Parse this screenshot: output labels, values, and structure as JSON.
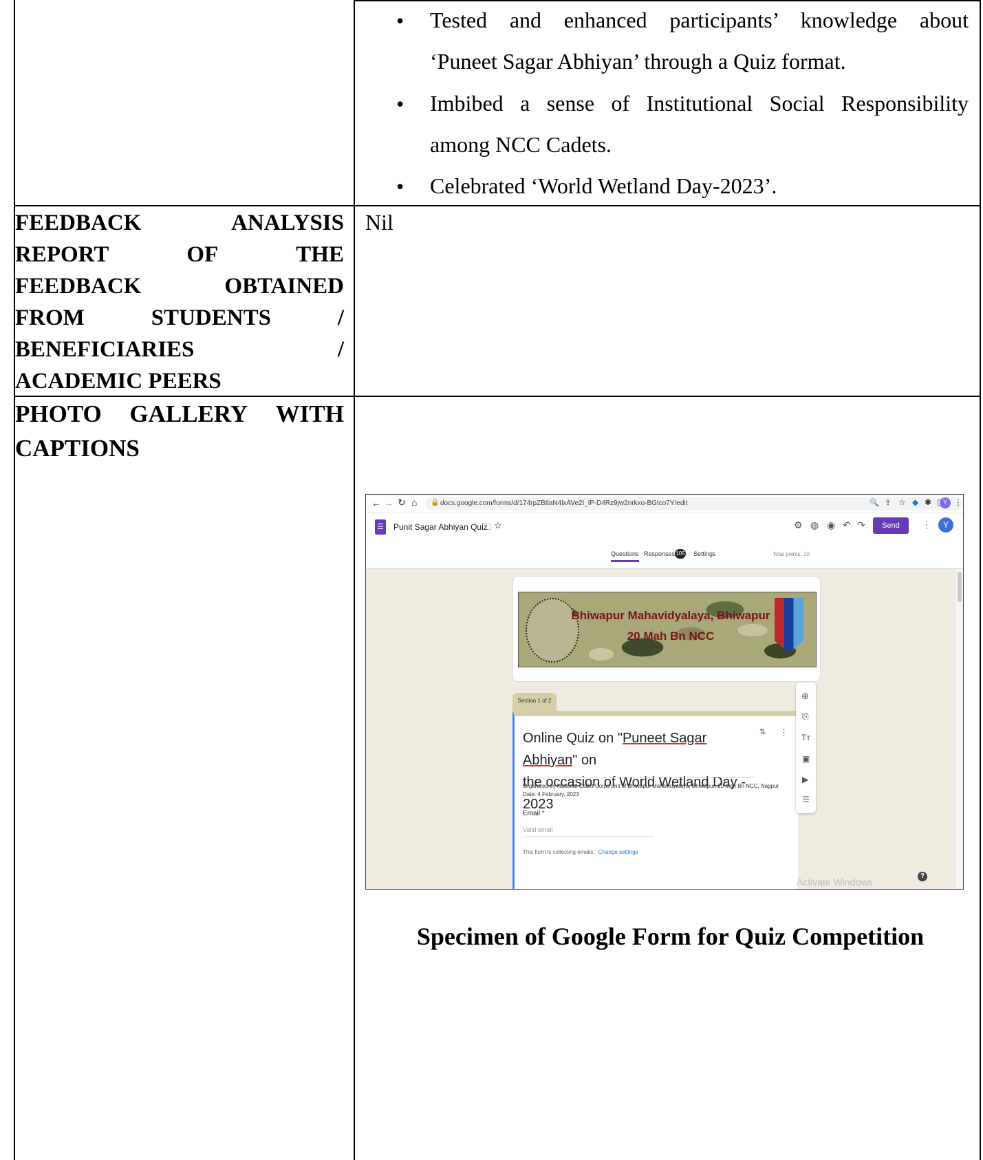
{
  "outcomes": {
    "bullet1_line1": "Tested and enhanced participants’ knowledge about",
    "bullet1_line2": "‘Puneet Sagar Abhiyan’ through a Quiz format.",
    "bullet2_line1": "Imbibed a sense of Institutional Social Responsibility",
    "bullet2_line2": "among NCC Cadets.",
    "bullet3": "Celebrated ‘World Wetland Day-2023’."
  },
  "feedback": {
    "label_lines": [
      [
        "FEEDBACK",
        "ANALYSIS"
      ],
      [
        "REPORT",
        "OF",
        "THE"
      ],
      [
        "FEEDBACK",
        "OBTAINED"
      ],
      [
        "FROM",
        "STUDENTS",
        "/"
      ],
      [
        "BENEFICIARIES",
        "/"
      ],
      [
        "ACADEMIC PEERS"
      ]
    ],
    "value": "Nil"
  },
  "gallery": {
    "label_line1": [
      "PHOTO",
      "GALLERY",
      "WITH"
    ],
    "label_line2": "CAPTIONS",
    "caption": "Specimen of Google Form for Quiz Competition"
  },
  "screenshot": {
    "url": "docs.google.com/forms/d/174rpZBtlaN4lxAVe2I_lP-D4Rz9jw2nrkxo-BGtco7Y/edit",
    "form_title": "Punit Sagar Abhiyan Quiz",
    "send_label": "Send",
    "avatar_letter": "Y",
    "tabs": {
      "questions": "Questions",
      "responses": "Responses",
      "responses_count": "105",
      "settings": "Settings"
    },
    "total_points": "Total points: 10",
    "banner_line1": "Bhiwapur Mahavidyalaya, Bhiwapur",
    "banner_line2": "20 Mah Bn NCC",
    "section_tab": "Section 1 of 2",
    "quiz_title_line1_pre": "Online Quiz on \"",
    "quiz_title_underlined": "Puneet Sagar Abhiyan",
    "quiz_title_line1_post": "\" on",
    "quiz_title_line2": "the occasion of World Wetland Day - 2023",
    "description_line1": "Organized by National Cadet Corps unit of Bhiwapur Mahavidyalaya, Bhiwapur, 20 Mah Bn NCC, Nagpur",
    "description_line2": "Date: 4 February, 2023",
    "email_label": "Email",
    "email_required": "*",
    "email_placeholder": "Valid email",
    "collecting_text": "This form is collecting emails.",
    "change_settings": "Change settings",
    "watermark": "Activate Windows",
    "help_symbol": "?"
  }
}
